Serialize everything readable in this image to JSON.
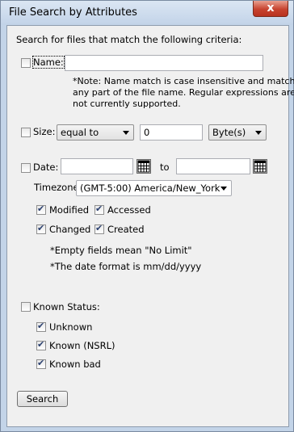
{
  "window": {
    "title": "File Search by Attributes",
    "close_glyph": "x"
  },
  "heading": "Search for files that match the following criteria:",
  "name": {
    "label": "Name:",
    "checked": false,
    "value": "",
    "note_lines": [
      "*Note: Name match is case insensitive and matches",
      "any part of the file name. Regular expressions are",
      "not currently supported."
    ]
  },
  "size": {
    "label": "Size:",
    "checked": false,
    "operator": "equal to",
    "value": "0",
    "unit": "Byte(s)"
  },
  "date": {
    "label": "Date:",
    "checked": false,
    "from_value": "",
    "to_label": "to",
    "to_value": "",
    "timezone_label": "Timezone:",
    "timezone": "(GMT-5:00) America/New_York",
    "modified_label": "Modified",
    "accessed_label": "Accessed",
    "changed_label": "Changed",
    "created_label": "Created",
    "note_empty": "*Empty fields mean \"No Limit\"",
    "note_format": "*The date format is mm/dd/yyyy"
  },
  "known_status": {
    "label": "Known Status:",
    "checked": false,
    "unknown_label": "Unknown",
    "known_nsrl_label": "Known (NSRL)",
    "known_bad_label": "Known bad"
  },
  "search_button": "Search"
}
